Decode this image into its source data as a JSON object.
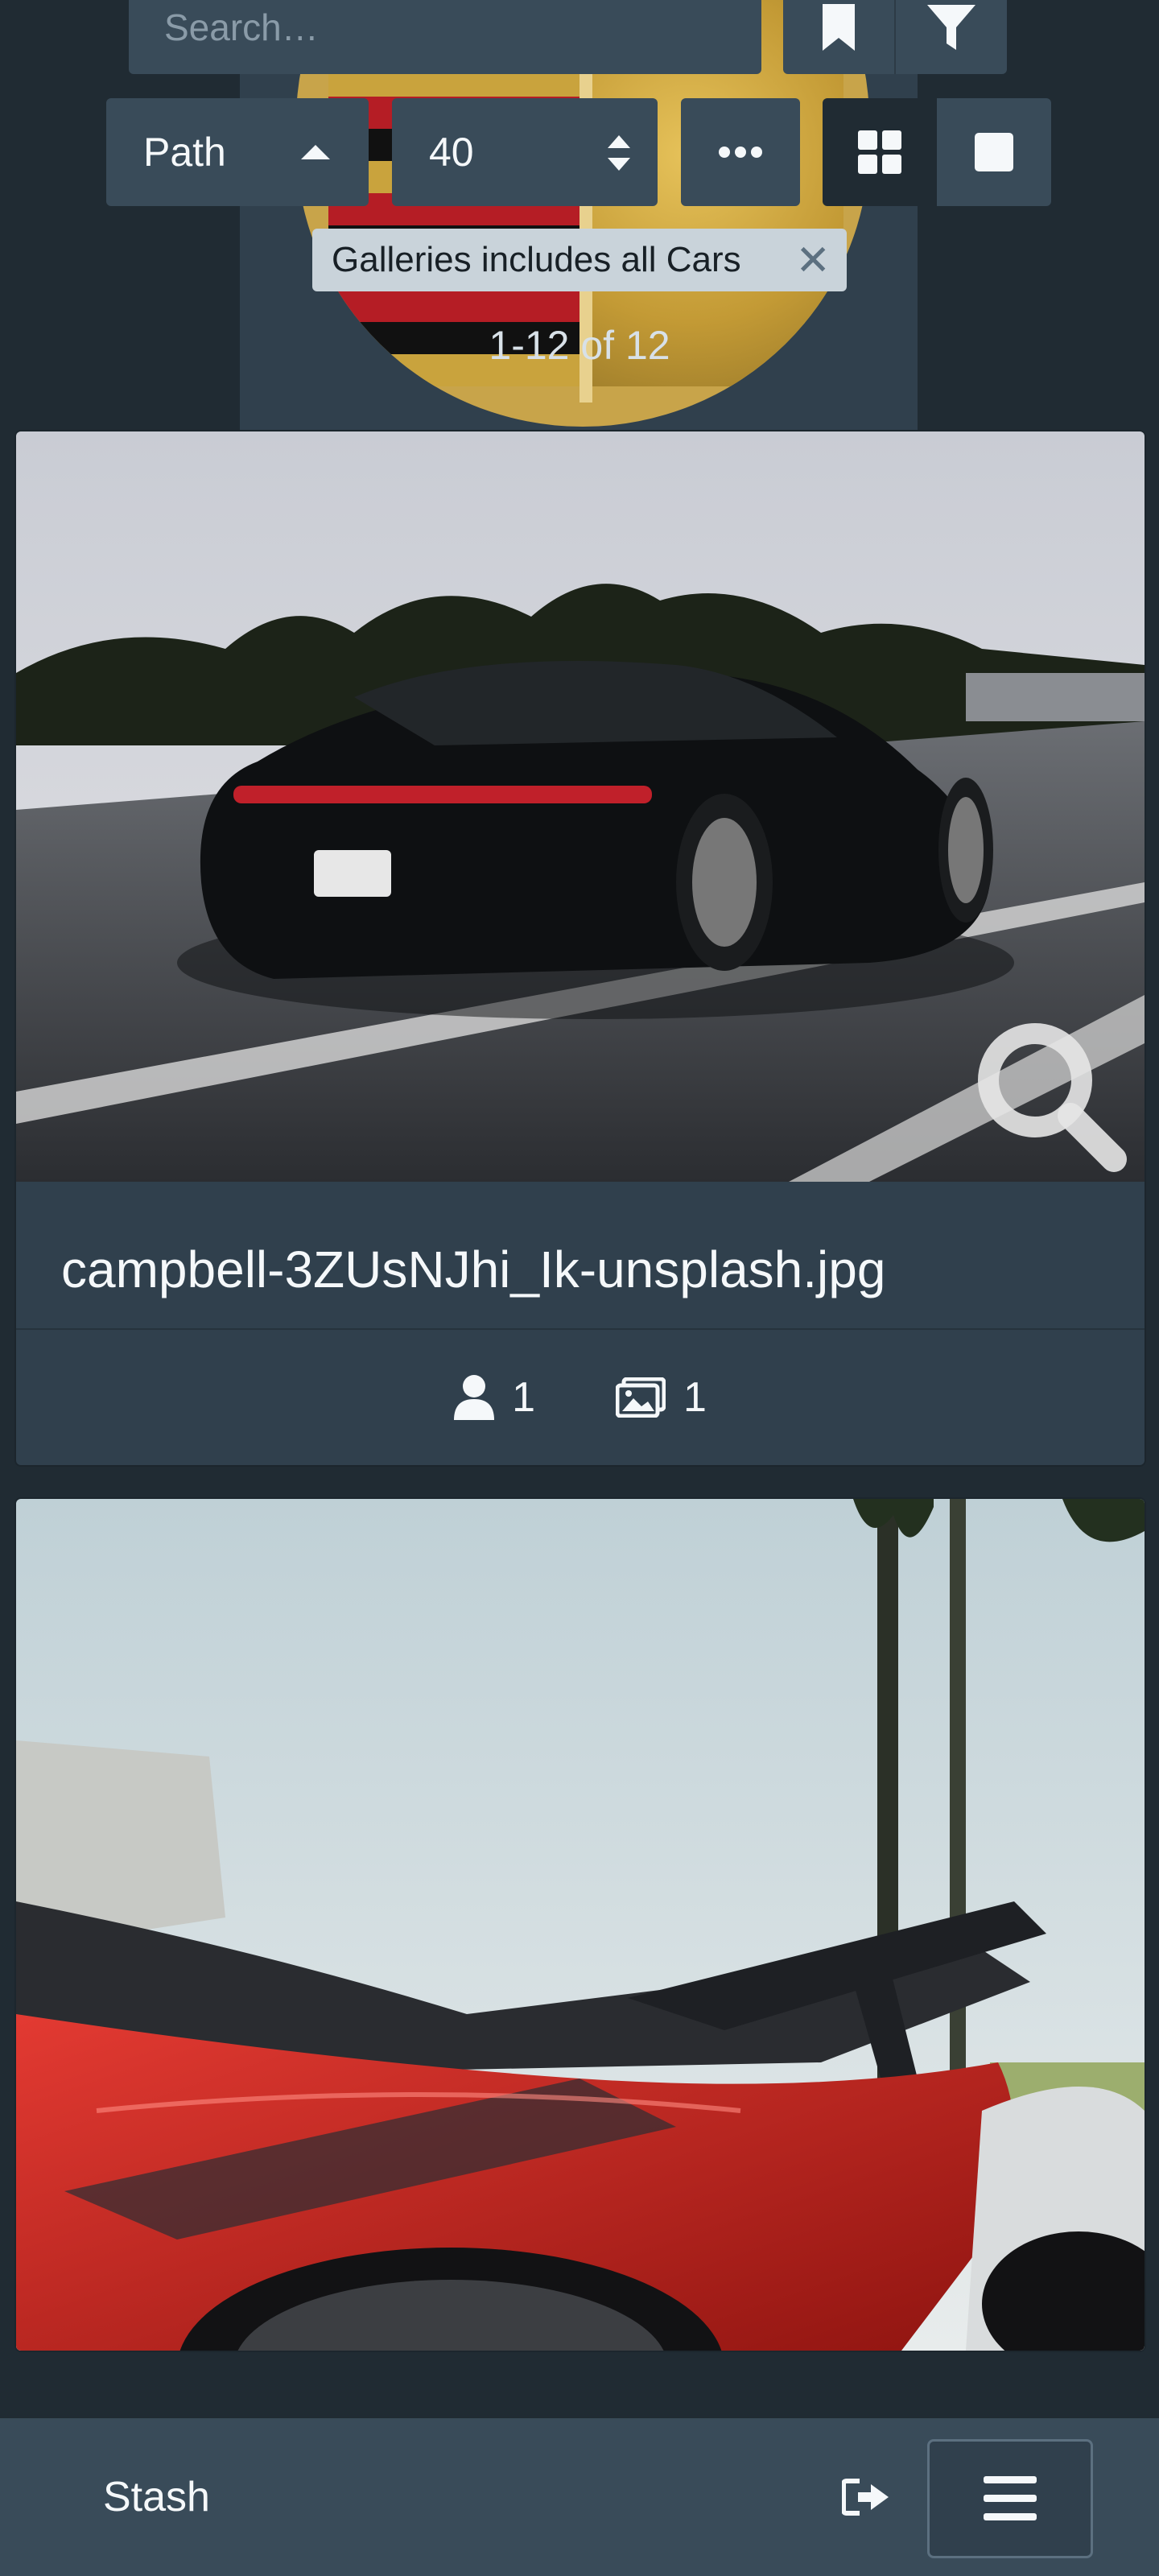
{
  "search": {
    "placeholder": "Search…"
  },
  "toolbar": {
    "sort_by": "Path",
    "per_page": "40",
    "more_label": "•••",
    "display_modes": [
      "grid",
      "list"
    ],
    "active_display_mode": "grid"
  },
  "filter": {
    "tag_label": "Galleries includes all Cars",
    "remove_label": "✕"
  },
  "results": {
    "count_text": "1-12 of 12"
  },
  "cards": [
    {
      "title": "campbell-3ZUsNJhi_Ik-unsplash.jpg",
      "performer_count": "1",
      "gallery_count": "1"
    }
  ],
  "navbar": {
    "brand": "Stash"
  },
  "colors": {
    "background": "#202b33",
    "panel": "#30404d",
    "control": "#394b59",
    "text": "#f5f8fa"
  },
  "icons": [
    "bookmark-icon",
    "filter-icon",
    "ellipsis-icon",
    "grid-icon",
    "square-icon",
    "remove-filter-icon",
    "magnify-icon",
    "user-icon",
    "images-icon",
    "sign-out-icon",
    "menu-icon"
  ]
}
